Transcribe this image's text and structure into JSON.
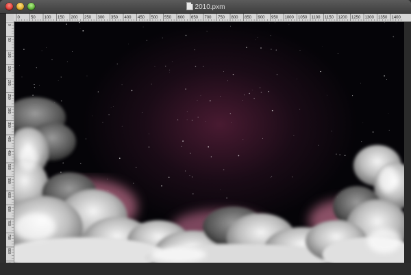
{
  "window": {
    "title": "2010.pxm",
    "buttons": [
      "close-button",
      "minimize-button",
      "zoom-button"
    ]
  },
  "rulers": {
    "horizontal_labels": [
      "0",
      "50",
      "100",
      "150",
      "200",
      "250",
      "300",
      "350",
      "400",
      "450",
      "500",
      "550",
      "600",
      "650",
      "700",
      "750",
      "800",
      "850",
      "900",
      "950",
      "1000",
      "1050",
      "1100",
      "1150",
      "1200",
      "1250",
      "1300",
      "1350",
      "1400"
    ],
    "vertical_labels": [
      "0",
      "50",
      "100",
      "150",
      "200",
      "250",
      "300",
      "350",
      "400",
      "450",
      "500",
      "550",
      "600",
      "650",
      "700",
      "750",
      "800",
      "850"
    ]
  },
  "canvas": {
    "description_colors": {
      "sky_top": "#050408",
      "nebula_glow": "#541e38",
      "cloud_white": "#e8e8e8",
      "cloud_pink": "#b86a86"
    }
  }
}
